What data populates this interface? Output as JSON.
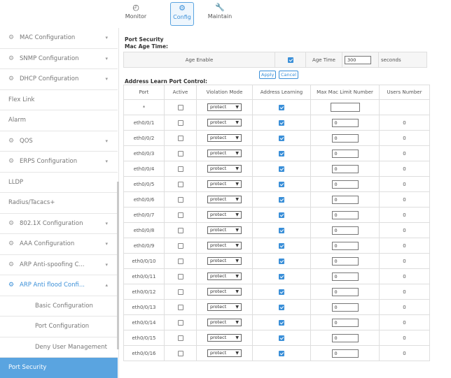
{
  "topnav": [
    {
      "label": "Monitor",
      "icon": "monitor-icon",
      "glyph": "◴",
      "active": false
    },
    {
      "label": "Config",
      "icon": "config-gear-icon",
      "glyph": "⚙",
      "active": true
    },
    {
      "label": "Maintain",
      "icon": "wrench-icon",
      "glyph": "🔧",
      "active": false
    }
  ],
  "sidebar": {
    "items": [
      {
        "label": "MAC Configuration",
        "gear": true,
        "chevron": "▾"
      },
      {
        "label": "SNMP Configuration",
        "gear": true,
        "chevron": "▾"
      },
      {
        "label": "DHCP Configuration",
        "gear": true,
        "chevron": "▾"
      },
      {
        "label": "Flex Link",
        "gear": false,
        "chevron": ""
      },
      {
        "label": "Alarm",
        "gear": false,
        "chevron": ""
      },
      {
        "label": "QOS",
        "gear": true,
        "chevron": "▾"
      },
      {
        "label": "ERPS Configuration",
        "gear": true,
        "chevron": "▾"
      },
      {
        "label": "LLDP",
        "gear": false,
        "chevron": ""
      },
      {
        "label": "Radius/Tacacs+",
        "gear": false,
        "chevron": ""
      },
      {
        "label": "802.1X Configuration",
        "gear": true,
        "chevron": "▾"
      },
      {
        "label": "AAA Configuration",
        "gear": true,
        "chevron": "▾"
      },
      {
        "label": "ARP Anti-spoofing C...",
        "gear": true,
        "chevron": "▾"
      },
      {
        "label": "ARP Anti flood Confi...",
        "gear": true,
        "chevron": "▴",
        "open": true
      },
      {
        "label": "Basic Configuration",
        "sub": true
      },
      {
        "label": "Port Configuration",
        "sub": true
      },
      {
        "label": "Deny User Management",
        "sub": true
      },
      {
        "label": "Port Security",
        "sel": true
      }
    ]
  },
  "content": {
    "section_title": "Port Security",
    "mac_age_title": "Mac Age Time:",
    "age_enable_label": "Age Enable",
    "age_enable_checked": true,
    "age_time_label": "Age Time",
    "age_time_value": "300",
    "age_time_unit": "seconds",
    "apply_label": "Apply",
    "cancel_label": "Cancel",
    "address_learn_title": "Address Learn Port Control:",
    "columns": [
      "Port",
      "Active",
      "Violation Mode",
      "Address Learning",
      "Max Mac Limit Number",
      "Users Number"
    ],
    "rows": [
      {
        "port": "*",
        "active": false,
        "mode": "protect",
        "learn": true,
        "max": "",
        "users": ""
      },
      {
        "port": "eth0/0/1",
        "active": false,
        "mode": "protect",
        "learn": true,
        "max": "0",
        "users": "0"
      },
      {
        "port": "eth0/0/2",
        "active": false,
        "mode": "protect",
        "learn": true,
        "max": "0",
        "users": "0"
      },
      {
        "port": "eth0/0/3",
        "active": false,
        "mode": "protect",
        "learn": true,
        "max": "0",
        "users": "0"
      },
      {
        "port": "eth0/0/4",
        "active": false,
        "mode": "protect",
        "learn": true,
        "max": "0",
        "users": "0"
      },
      {
        "port": "eth0/0/5",
        "active": false,
        "mode": "protect",
        "learn": true,
        "max": "0",
        "users": "0"
      },
      {
        "port": "eth0/0/6",
        "active": false,
        "mode": "protect",
        "learn": true,
        "max": "0",
        "users": "0"
      },
      {
        "port": "eth0/0/7",
        "active": false,
        "mode": "protect",
        "learn": true,
        "max": "0",
        "users": "0"
      },
      {
        "port": "eth0/0/8",
        "active": false,
        "mode": "protect",
        "learn": true,
        "max": "0",
        "users": "0"
      },
      {
        "port": "eth0/0/9",
        "active": false,
        "mode": "protect",
        "learn": true,
        "max": "0",
        "users": "0"
      },
      {
        "port": "eth0/0/10",
        "active": false,
        "mode": "protect",
        "learn": true,
        "max": "0",
        "users": "0"
      },
      {
        "port": "eth0/0/11",
        "active": false,
        "mode": "protect",
        "learn": true,
        "max": "0",
        "users": "0"
      },
      {
        "port": "eth0/0/12",
        "active": false,
        "mode": "protect",
        "learn": true,
        "max": "0",
        "users": "0"
      },
      {
        "port": "eth0/0/13",
        "active": false,
        "mode": "protect",
        "learn": true,
        "max": "0",
        "users": "0"
      },
      {
        "port": "eth0/0/14",
        "active": false,
        "mode": "protect",
        "learn": true,
        "max": "0",
        "users": "0"
      },
      {
        "port": "eth0/0/15",
        "active": false,
        "mode": "protect",
        "learn": true,
        "max": "0",
        "users": "0"
      },
      {
        "port": "eth0/0/16",
        "active": false,
        "mode": "protect",
        "learn": true,
        "max": "0",
        "users": "0"
      }
    ]
  },
  "colors": {
    "accent": "#3a8fd8",
    "selected_bg": "#5aa4e0"
  }
}
